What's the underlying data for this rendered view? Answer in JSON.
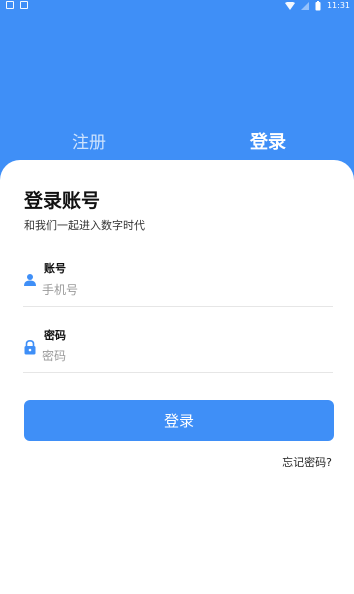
{
  "status": {
    "time": "11:31",
    "left_icons": [
      "notification-icon",
      "notification-icon"
    ],
    "right_icons": [
      "wifi-icon",
      "signal-icon",
      "battery-icon"
    ]
  },
  "tabs": {
    "register": "注册",
    "login": "登录"
  },
  "card": {
    "title": "登录账号",
    "subtitle": "和我们一起进入数字时代",
    "account": {
      "label": "账号",
      "placeholder": "手机号",
      "icon": "user-icon"
    },
    "password": {
      "label": "密码",
      "placeholder": "密码",
      "icon": "lock-icon"
    },
    "button": "登录",
    "forgot": "忘记密码?"
  },
  "colors": {
    "primary": "#3f8ff7",
    "background": "#ffffff"
  }
}
